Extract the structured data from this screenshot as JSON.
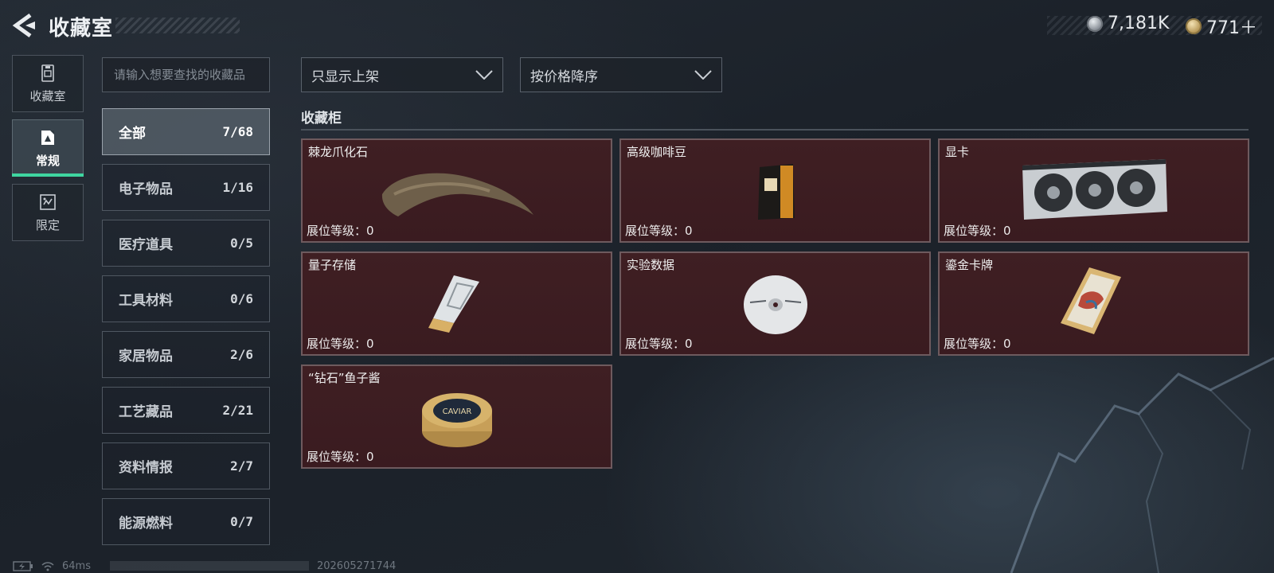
{
  "header": {
    "title": "收藏室",
    "currency_silver": "7,181K",
    "currency_gold": "771＋"
  },
  "leftnav": {
    "items": [
      {
        "label": "收藏室",
        "icon": "collection-room-icon",
        "active": false
      },
      {
        "label": "常规",
        "icon": "regular-icon",
        "active": true
      },
      {
        "label": "限定",
        "icon": "limited-icon",
        "active": false
      }
    ]
  },
  "search": {
    "placeholder": "请输入想要查找的收藏品"
  },
  "categories": [
    {
      "name": "全部",
      "count": "7/68",
      "active": true
    },
    {
      "name": "电子物品",
      "count": "1/16"
    },
    {
      "name": "医疗道具",
      "count": "0/5"
    },
    {
      "name": "工具材料",
      "count": "0/6"
    },
    {
      "name": "家居物品",
      "count": "2/6"
    },
    {
      "name": "工艺藏品",
      "count": "2/21"
    },
    {
      "name": "资料情报",
      "count": "2/7"
    },
    {
      "name": "能源燃料",
      "count": "0/7"
    }
  ],
  "filters": {
    "display": "只显示上架",
    "sort": "按价格降序"
  },
  "cabinet": {
    "title": "收藏柜",
    "items": [
      {
        "name": "棘龙爪化石",
        "level": "展位等级：0",
        "icon": "fossil-claw-icon"
      },
      {
        "name": "高级咖啡豆",
        "level": "展位等级：0",
        "icon": "coffee-bag-icon"
      },
      {
        "name": "显卡",
        "level": "展位等级：0",
        "icon": "graphics-card-icon"
      },
      {
        "name": "量子存储",
        "level": "展位等级：0",
        "icon": "quantum-storage-icon"
      },
      {
        "name": "实验数据",
        "level": "展位等级：0",
        "icon": "data-disc-icon"
      },
      {
        "name": "鎏金卡牌",
        "level": "展位等级：0",
        "icon": "gilded-card-icon"
      },
      {
        "name": "“钻石”鱼子酱",
        "level": "展位等级：0",
        "icon": "caviar-tin-icon"
      }
    ],
    "caviar_label": "CAVIAR"
  },
  "statusbar": {
    "ping": "64ms",
    "build": "202605271744"
  },
  "colors": {
    "accent": "#3fd6a0",
    "card_bg": "#3d1d21",
    "card_border": "#6e5a5e"
  }
}
